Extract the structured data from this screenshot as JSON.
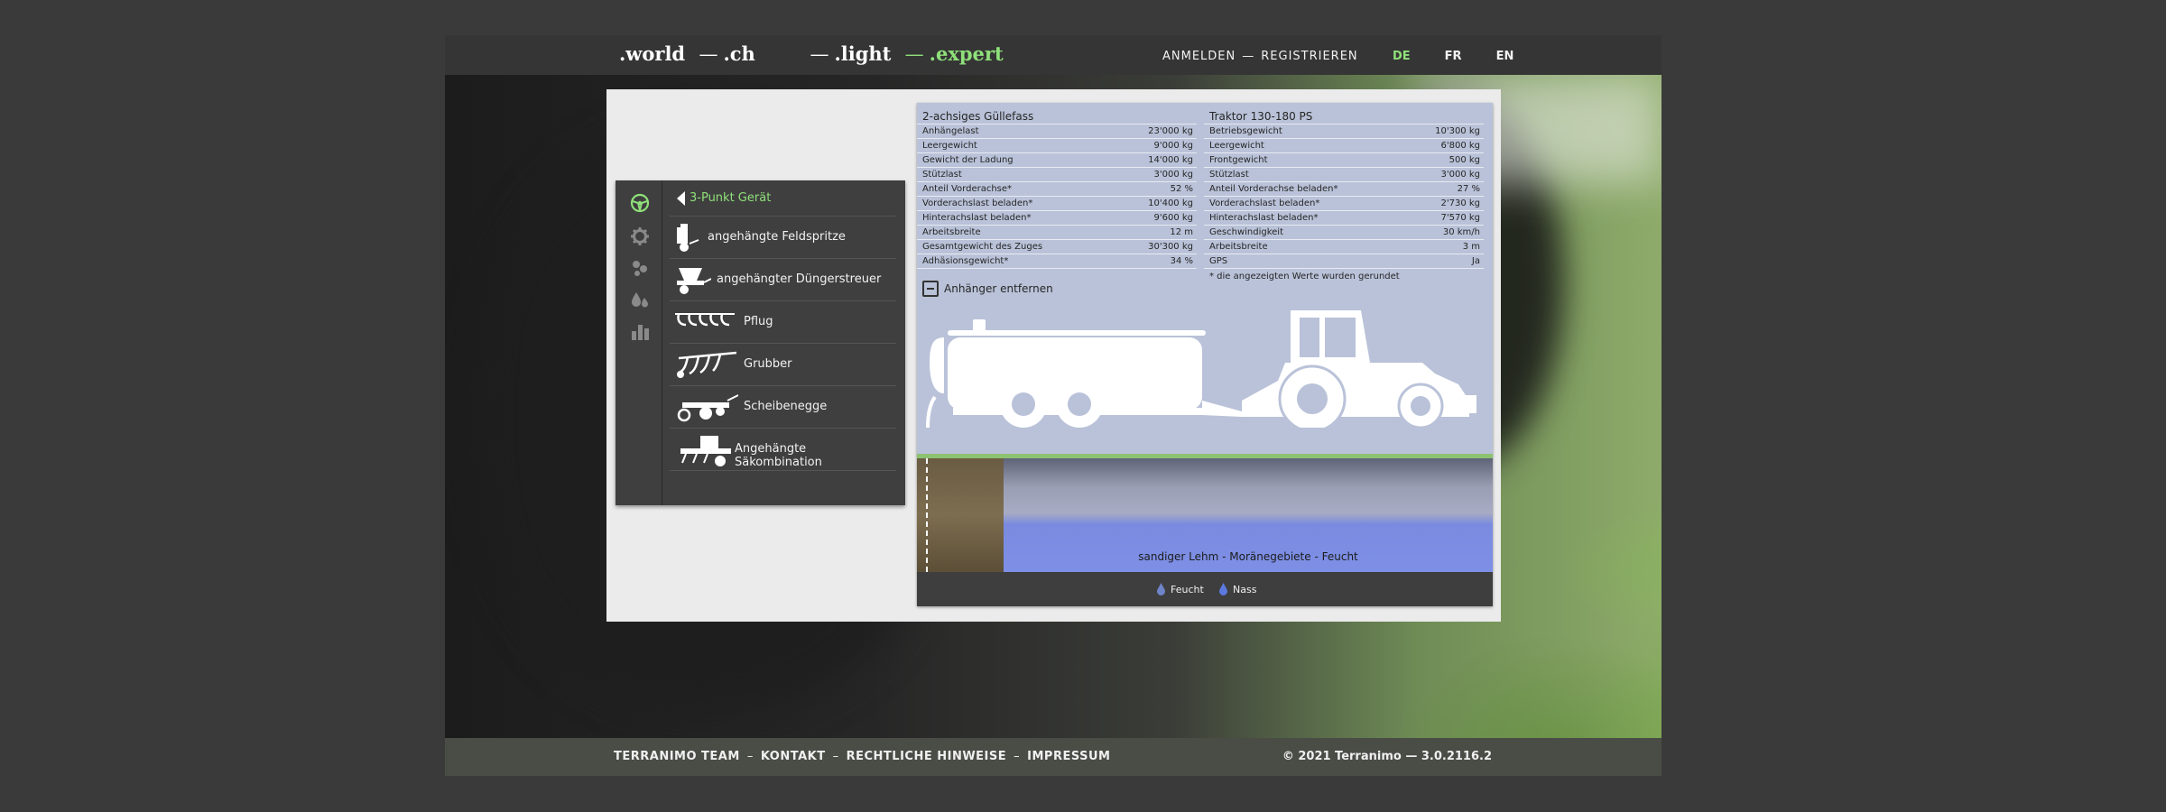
{
  "header": {
    "sites": [
      ".world",
      ".ch",
      ".light",
      ".expert"
    ],
    "site_sep": "—",
    "auth": {
      "login": "ANMELDEN",
      "sep": "—",
      "register": "REGISTRIEREN"
    },
    "languages": [
      "DE",
      "FR",
      "EN"
    ],
    "active_language": "DE",
    "accent_color": "#8fe07a"
  },
  "menu": {
    "side_icons": [
      "steering-wheel-icon",
      "gear-icon",
      "particles-icon",
      "drops-icon",
      "bar-chart-icon"
    ],
    "back_label": "3-Punkt Gerät",
    "items": [
      {
        "label": "angehängte Feldspritze",
        "icon": "field-sprayer-icon"
      },
      {
        "label": "angehängter Düngerstreuer",
        "icon": "fertilizer-spreader-icon"
      },
      {
        "label": "Pflug",
        "icon": "plough-icon"
      },
      {
        "label": "Grubber",
        "icon": "cultivator-icon"
      },
      {
        "label": "Scheibenegge",
        "icon": "disc-harrow-icon"
      },
      {
        "label": "Angehängte Säkombination",
        "icon": "seed-drill-icon"
      }
    ]
  },
  "trailer": {
    "title": "2-achsiges Güllefass",
    "rows": [
      {
        "label": "Anhängelast",
        "value": "23'000 kg"
      },
      {
        "label": "Leergewicht",
        "value": "9'000 kg"
      },
      {
        "label": "Gewicht der Ladung",
        "value": "14'000 kg"
      },
      {
        "label": "Stützlast",
        "value": "3'000 kg"
      },
      {
        "label": "Anteil Vorderachse*",
        "value": "52 %"
      },
      {
        "label": "Vorderachslast beladen*",
        "value": "10'400 kg"
      },
      {
        "label": "Hinterachslast beladen*",
        "value": "9'600 kg"
      },
      {
        "label": "Arbeitsbreite",
        "value": "12 m"
      },
      {
        "label": "Gesamtgewicht des Zuges",
        "value": "30'300 kg"
      },
      {
        "label": "Adhäsionsgewicht*",
        "value": "34 %"
      }
    ]
  },
  "tractor": {
    "title": "Traktor 130-180 PS",
    "rows": [
      {
        "label": "Betriebsgewicht",
        "value": "10'300 kg"
      },
      {
        "label": "Leergewicht",
        "value": "6'800 kg"
      },
      {
        "label": "Frontgewicht",
        "value": "500 kg"
      },
      {
        "label": "Stützlast",
        "value": "3'000 kg"
      },
      {
        "label": "Anteil Vorderachse beladen*",
        "value": "27 %"
      },
      {
        "label": "Vorderachslast beladen*",
        "value": "2'730 kg"
      },
      {
        "label": "Hinterachslast beladen*",
        "value": "7'570 kg"
      },
      {
        "label": "Geschwindigkeit",
        "value": "30 km/h"
      },
      {
        "label": "Arbeitsbreite",
        "value": "3 m"
      },
      {
        "label": "GPS",
        "value": "Ja"
      }
    ]
  },
  "note": "* die angezeigten Werte wurden gerundet",
  "remove_trailer": "Anhänger entfernen",
  "soil": {
    "label": "sandiger Lehm - Moränegebiete - Feucht"
  },
  "legend": [
    {
      "label": "Feucht",
      "color": "#6f84c9"
    },
    {
      "label": "Nass",
      "color": "#5c79e0"
    }
  ],
  "footer": {
    "links": [
      "TERRANIMO TEAM",
      "KONTAKT",
      "RECHTLICHE HINWEISE",
      "IMPRESSUM"
    ],
    "sep": "–",
    "copyright": "© 2021 Terranimo — 3.0.2116.2"
  }
}
